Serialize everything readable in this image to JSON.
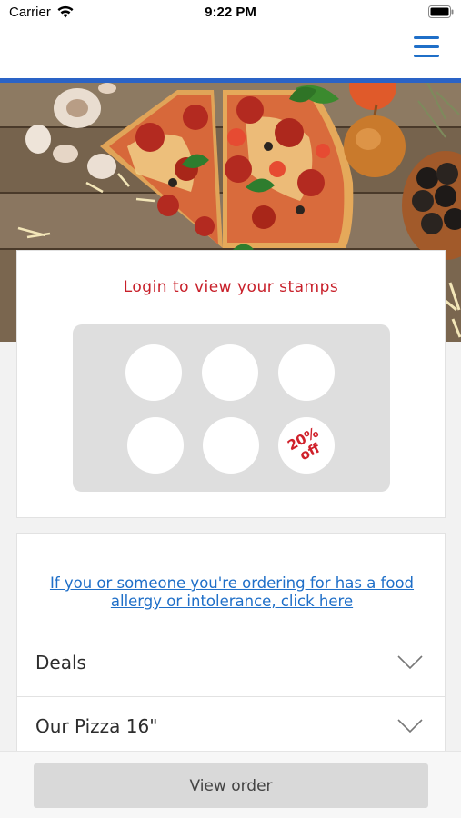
{
  "status_bar": {
    "carrier": "Carrier",
    "time": "9:22 PM"
  },
  "nav": {
    "menu_icon": "hamburger-menu-icon",
    "accent_color": "#2a63c6"
  },
  "hero": {
    "image": "pizza-on-wooden-table"
  },
  "stamp_card": {
    "title": "Login to view your stamps",
    "title_color": "#c8202a",
    "stamps_total": 6,
    "reward_text": "20%\noff"
  },
  "menu": {
    "allergy_link": "If you or someone you're ordering for has a food allergy or intolerance, click here",
    "sections": [
      {
        "label": "Deals"
      },
      {
        "label": "Our Pizza 16\""
      }
    ]
  },
  "footer": {
    "view_order_label": "View order"
  }
}
